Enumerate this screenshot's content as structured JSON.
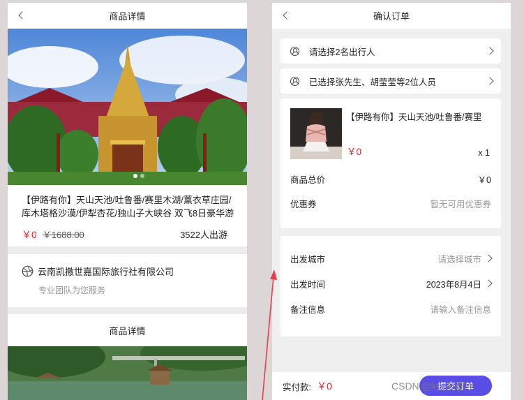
{
  "left": {
    "header_title": "商品详情",
    "product": {
      "title": "【伊路有你】天山天池/吐鲁番/赛里木湖/薰衣草庄园/库木塔格沙漠/伊犁杏花/独山子大峡谷 双飞8日豪华游",
      "price": "￥0",
      "original_price": "￥1688.00",
      "trips": "3522人出游"
    },
    "carousel": {
      "active_index": 0,
      "total": 2
    },
    "agency": {
      "name": "云南凯撒世嘉国际旅行社有限公司",
      "subtitle": "专业团队为您服务",
      "icon": "globe-icon"
    },
    "section_title": "商品详情"
  },
  "right": {
    "header_title": "确认订单",
    "travelers": [
      {
        "label": "请选择2名出行人",
        "icon": "person-icon"
      },
      {
        "label": "已选择张先生、胡莹莹等2位人员",
        "icon": "person-icon"
      }
    ],
    "order": {
      "title": "【伊路有你】天山天池/吐鲁番/赛里",
      "price": "￥0",
      "qty": "x 1",
      "total_label": "商品总价",
      "total_value": "￥0",
      "coupon_label": "优惠券",
      "coupon_value": "暂无可用优惠券"
    },
    "trip": {
      "city_label": "出发城市",
      "city_value": "请选择城市",
      "time_label": "出发时间",
      "time_value": "2023年8月4日",
      "note_label": "备注信息",
      "note_placeholder": "请输入备注信息"
    },
    "footer": {
      "pay_label": "实付款:",
      "pay_value": "￥0",
      "submit_label": "提交订单"
    }
  },
  "watermark": "CSDN @kunkeji01",
  "colors": {
    "price_red": "#e8242c",
    "button_purple": "#5a4de6",
    "annotation_arrow": "#e8404a"
  }
}
